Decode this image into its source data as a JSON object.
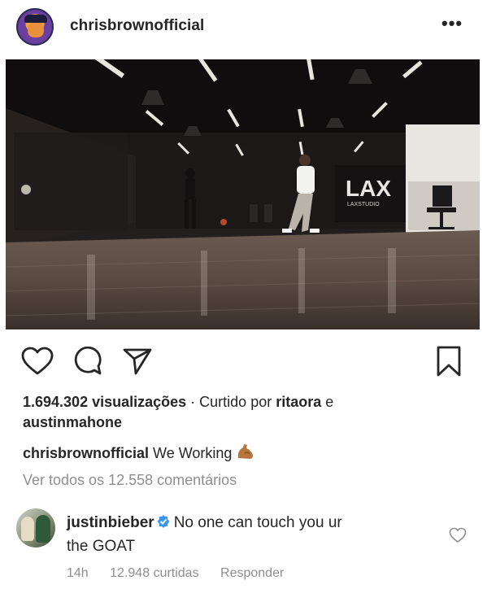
{
  "post": {
    "username": "chrisbrownofficial",
    "more_icon": "more-options-icon",
    "views": "1.694.302 visualizações",
    "liked_by_prefix": "· Curtido por",
    "liked_by_user1": "ritaora",
    "liked_by_and": "e",
    "liked_by_user2": "austinmahone",
    "caption_user": "chrisbrownofficial",
    "caption_text": "We Working",
    "caption_emoji": "flexed-biceps-emoji",
    "view_all_comments": "Ver todos os 12.558 comentários"
  },
  "video": {
    "studio_logo": "LAX",
    "studio_sub": "LAXSTUDIO"
  },
  "actions": {
    "like_icon": "heart-icon",
    "comment_icon": "comment-icon",
    "share_icon": "send-icon",
    "save_icon": "bookmark-icon"
  },
  "comment": {
    "username": "justinbieber",
    "text_part1": "No one can touch you ur",
    "text_part2": "the GOAT",
    "time": "14h",
    "likes": "12.948 curtidas",
    "reply": "Responder"
  },
  "colors": {
    "text": "#262626",
    "muted": "#8e8e8e",
    "verified": "#3897f0"
  }
}
